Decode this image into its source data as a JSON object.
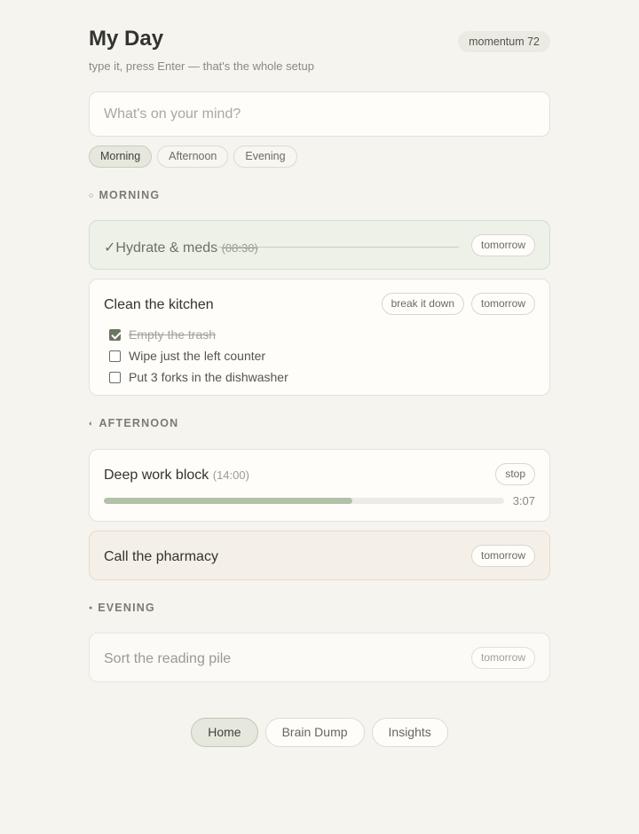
{
  "header": {
    "title": "My Day",
    "subtitle": "type it, press Enter — that's the whole setup",
    "momentum": "momentum 72"
  },
  "composer": {
    "placeholder": "What's on your mind?",
    "value": ""
  },
  "filters": [
    {
      "label": "Morning",
      "active": true
    },
    {
      "label": "Afternoon",
      "active": false
    },
    {
      "label": "Evening",
      "active": false
    }
  ],
  "sections": {
    "morning": {
      "icon": "empty-circle-icon",
      "icon_glyph": "○",
      "label": "MORNING",
      "tasks": [
        {
          "check": "✓",
          "title": "Hydrate & meds",
          "time": "(08:30)",
          "done": true,
          "action": "tomorrow"
        },
        {
          "title": "Clean the kitchen",
          "actions": [
            "break it down",
            "tomorrow"
          ],
          "subtasks": [
            {
              "label": "Empty the trash",
              "done": true
            },
            {
              "label": "Wipe just the left counter",
              "done": false
            },
            {
              "label": "Put 3 forks in the dishwasher",
              "done": false
            }
          ]
        }
      ]
    },
    "afternoon": {
      "icon": "half-circle-icon",
      "icon_glyph": "◐",
      "label": "AFTERNOON",
      "tasks": [
        {
          "title": "Deep work block",
          "time": "(14:00)",
          "action": "stop",
          "progress": 0.62,
          "timer": "3:07"
        },
        {
          "title": "Call the pharmacy",
          "action": "tomorrow"
        }
      ]
    },
    "evening": {
      "icon": "filled-dot-icon",
      "icon_glyph": "●",
      "label": "EVENING",
      "tasks": [
        {
          "title": "Sort the reading pile",
          "action": "tomorrow"
        }
      ]
    }
  },
  "nav": [
    {
      "label": "Home",
      "active": true
    },
    {
      "label": "Brain Dump",
      "active": false
    },
    {
      "label": "Insights",
      "active": false
    }
  ]
}
